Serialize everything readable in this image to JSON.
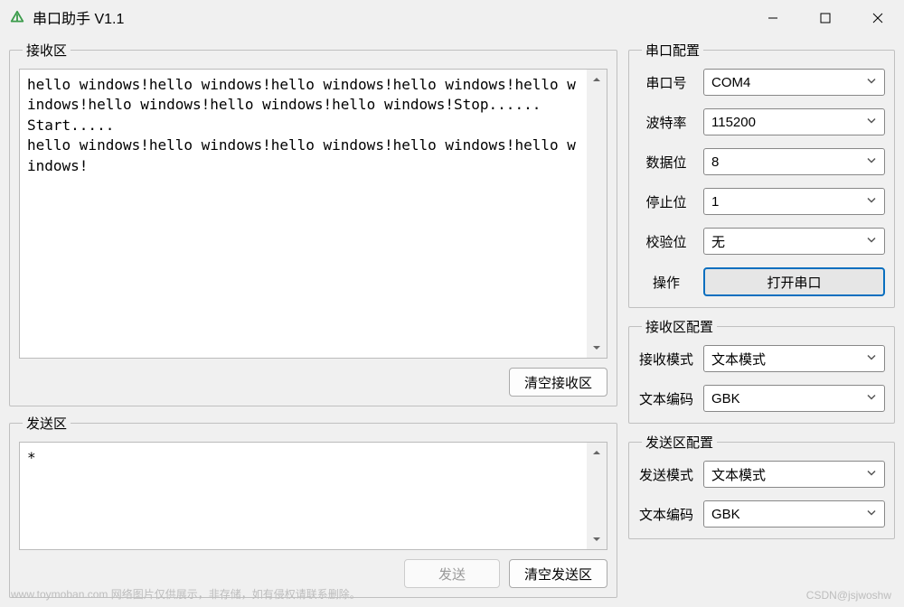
{
  "window": {
    "title": "串口助手 V1.1"
  },
  "receive": {
    "legend": "接收区",
    "text": "hello windows!hello windows!hello windows!hello windows!hello windows!hello windows!hello windows!hello windows!Stop......\nStart.....\nhello windows!hello windows!hello windows!hello windows!hello windows!",
    "clear_btn": "清空接收区"
  },
  "send": {
    "legend": "发送区",
    "text": "*",
    "send_btn": "发送",
    "clear_btn": "清空发送区"
  },
  "serial_cfg": {
    "legend": "串口配置",
    "rows": {
      "port": {
        "label": "串口号",
        "value": "COM4"
      },
      "baud": {
        "label": "波特率",
        "value": "115200"
      },
      "databits": {
        "label": "数据位",
        "value": "8"
      },
      "stopbits": {
        "label": "停止位",
        "value": "1"
      },
      "parity": {
        "label": "校验位",
        "value": "无"
      },
      "op": {
        "label": "操作",
        "value": "打开串口"
      }
    }
  },
  "recv_cfg": {
    "legend": "接收区配置",
    "rows": {
      "mode": {
        "label": "接收模式",
        "value": "文本模式"
      },
      "enc": {
        "label": "文本编码",
        "value": "GBK"
      }
    }
  },
  "send_cfg": {
    "legend": "发送区配置",
    "rows": {
      "mode": {
        "label": "发送模式",
        "value": "文本模式"
      },
      "enc": {
        "label": "文本编码",
        "value": "GBK"
      }
    }
  },
  "watermark": {
    "left": "www.toymoban.com 网络图片仅供展示，非存储，如有侵权请联系删除。",
    "right": "CSDN@jsjwoshw"
  }
}
